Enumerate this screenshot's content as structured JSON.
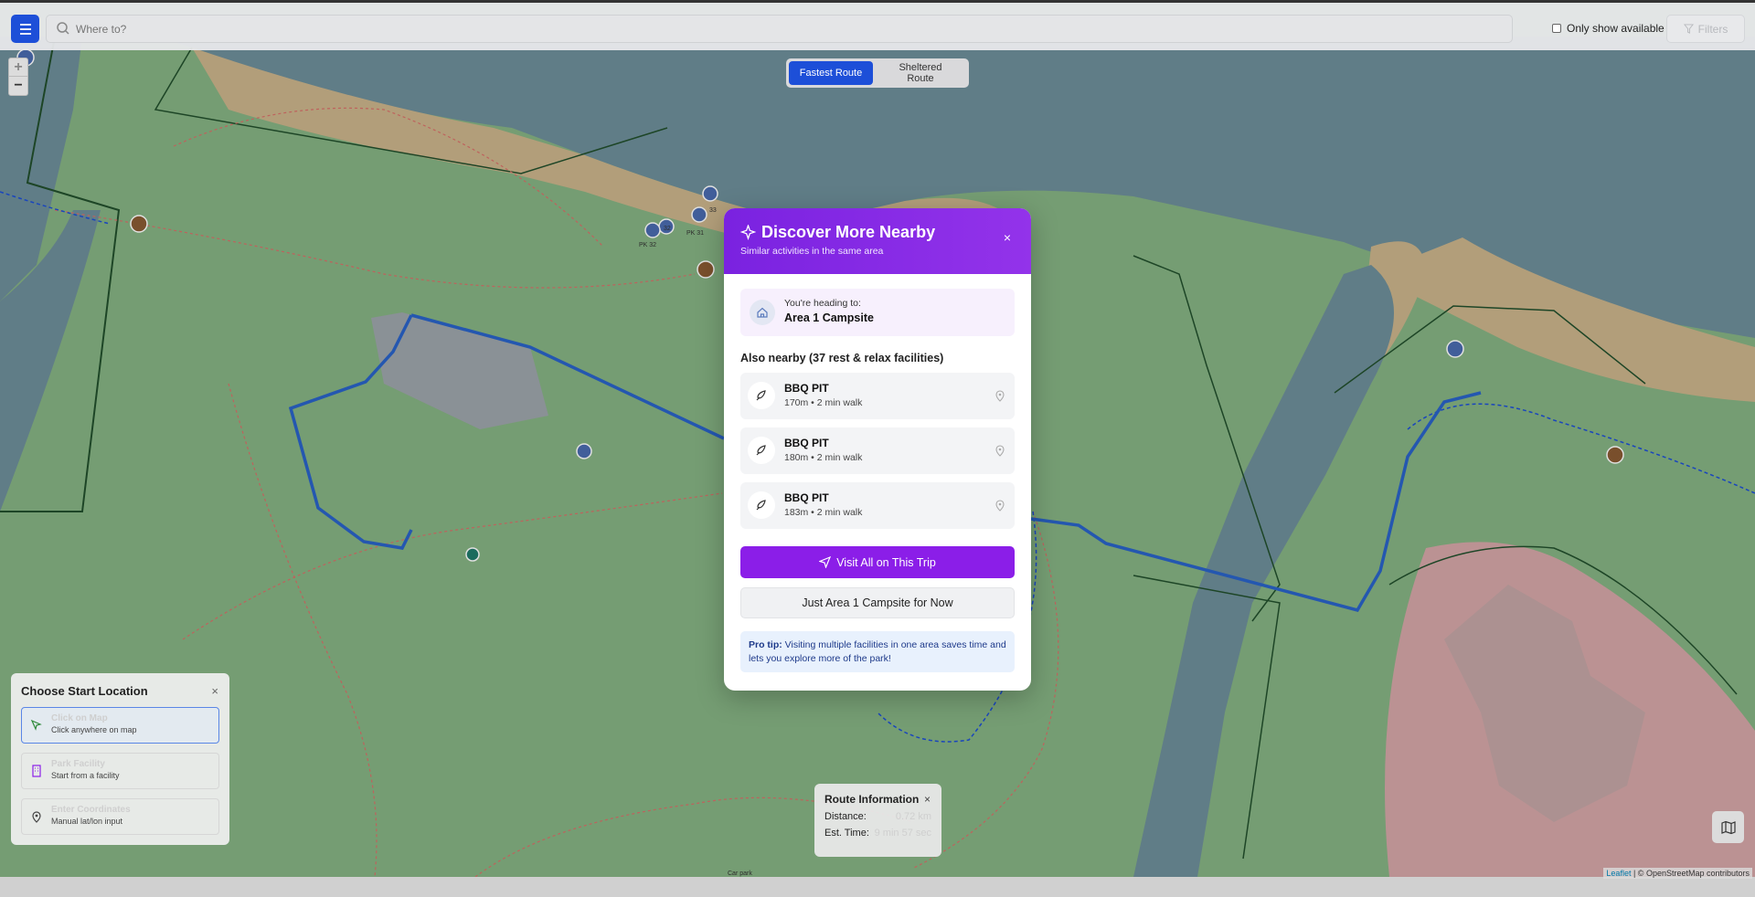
{
  "topbar": {
    "search_placeholder": "Where to?",
    "only_available_label": "Only show available",
    "filters_label": "Filters",
    "menu_icon": "hamburger-menu-icon"
  },
  "zoom": {
    "in": "+",
    "out": "−"
  },
  "route_toggle": {
    "fastest": "Fastest Route",
    "sheltered": "Sheltered Route",
    "active": "fastest"
  },
  "modal": {
    "title": "Discover More Nearby",
    "subtitle": "Similar activities in the same area",
    "heading_label": "You're heading to:",
    "destination": "Area 1 Campsite",
    "nearby_title": "Also nearby (37 rest & relax facilities)",
    "facilities": [
      {
        "name": "BBQ PIT",
        "detail": "170m • 2 min walk"
      },
      {
        "name": "BBQ PIT",
        "detail": "180m • 2 min walk"
      },
      {
        "name": "BBQ PIT",
        "detail": "183m • 2 min walk"
      }
    ],
    "visit_all_label": "Visit All on This Trip",
    "just_label": "Just Area 1 Campsite for Now",
    "tip_prefix": "Pro tip:",
    "tip_text": "Visiting multiple facilities in one area saves time and lets you explore more of the park!",
    "close": "×"
  },
  "start_panel": {
    "title": "Choose Start Location",
    "close": "×",
    "options": [
      {
        "title": "Click on Map",
        "subtitle": "Click anywhere on map"
      },
      {
        "title": "Park Facility",
        "subtitle": "Start from a facility"
      },
      {
        "title": "Enter Coordinates",
        "subtitle": "Manual lat/lon input"
      }
    ]
  },
  "route_info": {
    "title": "Route Information",
    "close": "×",
    "distance_label": "Distance:",
    "distance_value": "0.72 km",
    "time_label": "Est. Time:",
    "time_value": "9 min 57 sec"
  },
  "attribution": {
    "leaflet": "Leaflet",
    "osm": "| © OpenStreetMap contributors"
  },
  "map_labels": {
    "pk1": "PK 32",
    "pk2": "PK 31",
    "n1": "32",
    "n2": "33",
    "car": "Car park"
  },
  "colors": {
    "primary": "#1d4fd8",
    "accent": "#8b1ee8",
    "water": "#6e8f9a",
    "park": "#86b383"
  }
}
